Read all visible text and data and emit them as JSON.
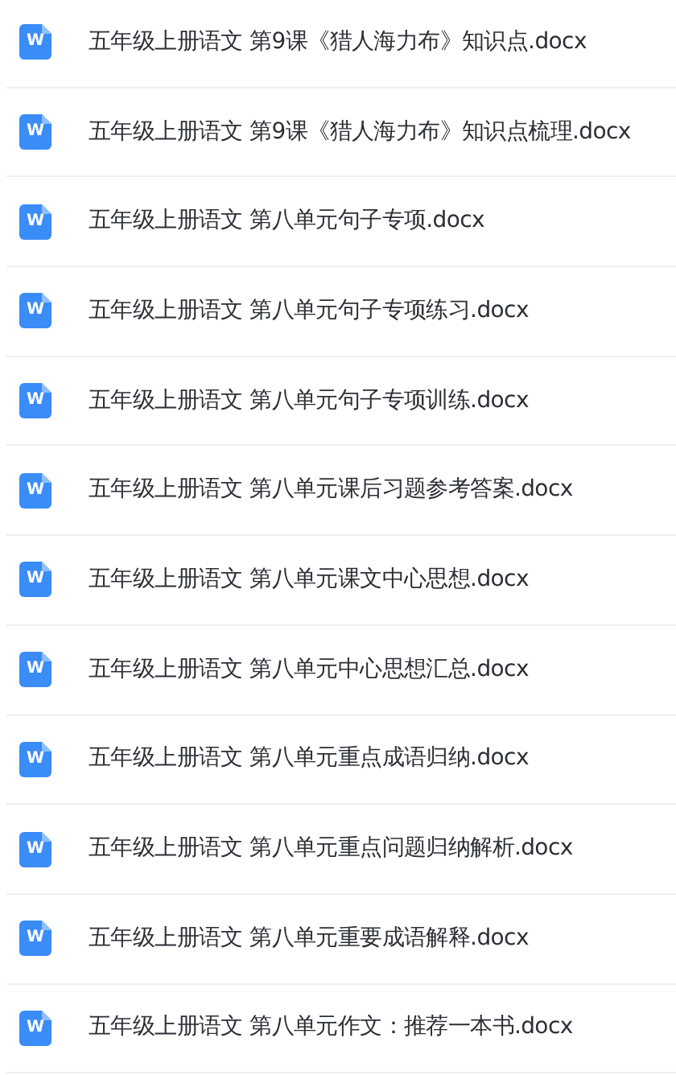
{
  "files": [
    {
      "icon_letter": "W",
      "name": "五年级上册语文 第9课《猎人海力布》知识点.docx"
    },
    {
      "icon_letter": "W",
      "name": "五年级上册语文 第9课《猎人海力布》知识点梳理.docx"
    },
    {
      "icon_letter": "W",
      "name": "五年级上册语文 第八单元句子专项.docx"
    },
    {
      "icon_letter": "W",
      "name": "五年级上册语文 第八单元句子专项练习.docx"
    },
    {
      "icon_letter": "W",
      "name": "五年级上册语文 第八单元句子专项训练.docx"
    },
    {
      "icon_letter": "W",
      "name": "五年级上册语文 第八单元课后习题参考答案.docx"
    },
    {
      "icon_letter": "W",
      "name": "五年级上册语文 第八单元课文中心思想.docx"
    },
    {
      "icon_letter": "W",
      "name": "五年级上册语文 第八单元中心思想汇总.docx"
    },
    {
      "icon_letter": "W",
      "name": "五年级上册语文 第八单元重点成语归纳.docx"
    },
    {
      "icon_letter": "W",
      "name": "五年级上册语文 第八单元重点问题归纳解析.docx"
    },
    {
      "icon_letter": "W",
      "name": "五年级上册语文 第八单元重要成语解释.docx"
    },
    {
      "icon_letter": "W",
      "name": "五年级上册语文 第八单元作文：推荐一本书.docx"
    }
  ]
}
